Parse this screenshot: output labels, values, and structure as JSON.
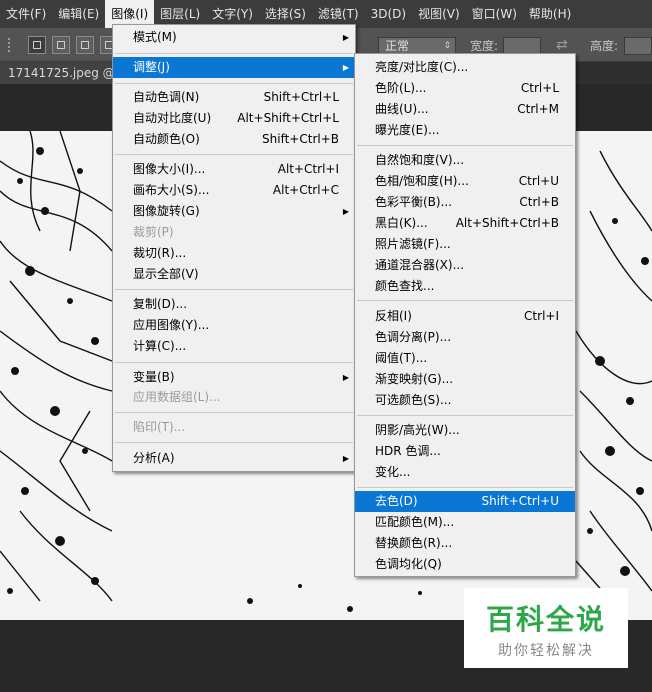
{
  "menubar": {
    "items": [
      "文件(F)",
      "编辑(E)",
      "图像(I)",
      "图层(L)",
      "文字(Y)",
      "选择(S)",
      "滤镜(T)",
      "3D(D)",
      "视图(V)",
      "窗口(W)",
      "帮助(H)"
    ]
  },
  "options": {
    "style_value": "正常",
    "width_label": "宽度:",
    "height_label": "高度:"
  },
  "document": {
    "tab_title": "17141725.jpeg @"
  },
  "image_menu": {
    "items": [
      {
        "label": "模式(M)",
        "shortcut": "",
        "submenu": true
      },
      {
        "label": "调整(J)",
        "shortcut": "",
        "submenu": true
      },
      {
        "label": "自动色调(N)",
        "shortcut": "Shift+Ctrl+L"
      },
      {
        "label": "自动对比度(U)",
        "shortcut": "Alt+Shift+Ctrl+L"
      },
      {
        "label": "自动颜色(O)",
        "shortcut": "Shift+Ctrl+B"
      },
      {
        "label": "图像大小(I)...",
        "shortcut": "Alt+Ctrl+I"
      },
      {
        "label": "画布大小(S)...",
        "shortcut": "Alt+Ctrl+C"
      },
      {
        "label": "图像旋转(G)",
        "shortcut": "",
        "submenu": true
      },
      {
        "label": "裁剪(P)",
        "shortcut": "",
        "disabled": true
      },
      {
        "label": "裁切(R)...",
        "shortcut": ""
      },
      {
        "label": "显示全部(V)",
        "shortcut": ""
      },
      {
        "label": "复制(D)...",
        "shortcut": ""
      },
      {
        "label": "应用图像(Y)...",
        "shortcut": ""
      },
      {
        "label": "计算(C)...",
        "shortcut": ""
      },
      {
        "label": "变量(B)",
        "shortcut": "",
        "submenu": true
      },
      {
        "label": "应用数据组(L)...",
        "shortcut": "",
        "disabled": true
      },
      {
        "label": "陷印(T)...",
        "shortcut": "",
        "disabled": true
      },
      {
        "label": "分析(A)",
        "shortcut": "",
        "submenu": true
      }
    ]
  },
  "adjust_menu": {
    "items": [
      {
        "label": "亮度/对比度(C)...",
        "shortcut": ""
      },
      {
        "label": "色阶(L)...",
        "shortcut": "Ctrl+L"
      },
      {
        "label": "曲线(U)...",
        "shortcut": "Ctrl+M"
      },
      {
        "label": "曝光度(E)...",
        "shortcut": ""
      },
      {
        "label": "自然饱和度(V)...",
        "shortcut": ""
      },
      {
        "label": "色相/饱和度(H)...",
        "shortcut": "Ctrl+U"
      },
      {
        "label": "色彩平衡(B)...",
        "shortcut": "Ctrl+B"
      },
      {
        "label": "黑白(K)...",
        "shortcut": "Alt+Shift+Ctrl+B"
      },
      {
        "label": "照片滤镜(F)...",
        "shortcut": ""
      },
      {
        "label": "通道混合器(X)...",
        "shortcut": ""
      },
      {
        "label": "颜色查找...",
        "shortcut": ""
      },
      {
        "label": "反相(I)",
        "shortcut": "Ctrl+I"
      },
      {
        "label": "色调分离(P)...",
        "shortcut": ""
      },
      {
        "label": "阈值(T)...",
        "shortcut": ""
      },
      {
        "label": "渐变映射(G)...",
        "shortcut": ""
      },
      {
        "label": "可选颜色(S)...",
        "shortcut": ""
      },
      {
        "label": "阴影/高光(W)...",
        "shortcut": ""
      },
      {
        "label": "HDR 色调...",
        "shortcut": ""
      },
      {
        "label": "变化...",
        "shortcut": ""
      },
      {
        "label": "去色(D)",
        "shortcut": "Shift+Ctrl+U"
      },
      {
        "label": "匹配颜色(M)...",
        "shortcut": ""
      },
      {
        "label": "替换颜色(R)...",
        "shortcut": ""
      },
      {
        "label": "色调均化(Q)",
        "shortcut": ""
      }
    ]
  },
  "watermark": {
    "title": "百科全说",
    "subtitle": "助你轻松解决"
  },
  "colors": {
    "highlight": "#0a77d5",
    "watermark_green": "#2ca84a",
    "menu_bg": "#f0f0f0"
  }
}
